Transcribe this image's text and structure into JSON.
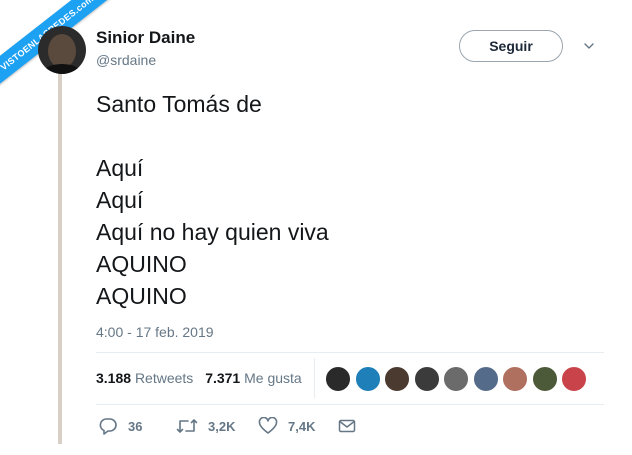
{
  "watermark": "VISTOENLASREDES.com",
  "user": {
    "name": "Sinior Daine",
    "handle": "@srdaine"
  },
  "follow_label": "Seguir",
  "tweet": {
    "text": "Santo Tomás de\n\nAquí\nAquí\nAquí no hay quien viva\nAQUINO\nAQUINO",
    "timestamp": "4:00 - 17 feb. 2019"
  },
  "stats": {
    "retweets_count": "3.188",
    "retweets_label": "Retweets",
    "likes_count": "7.371",
    "likes_label": "Me gusta"
  },
  "likers": [
    {
      "color": "#2a2a2a"
    },
    {
      "color": "#1f7fb8"
    },
    {
      "color": "#4a3a30"
    },
    {
      "color": "#3b3b3b"
    },
    {
      "color": "#6b6b6b"
    },
    {
      "color": "#556b8a"
    },
    {
      "color": "#b07060"
    },
    {
      "color": "#4d5a3a"
    },
    {
      "color": "#c9434a"
    }
  ],
  "actions": {
    "reply_count": "36",
    "retweet_count": "3,2K",
    "like_count": "7,4K"
  },
  "colors": {
    "accent": "#1da1f2",
    "muted": "#657786"
  }
}
